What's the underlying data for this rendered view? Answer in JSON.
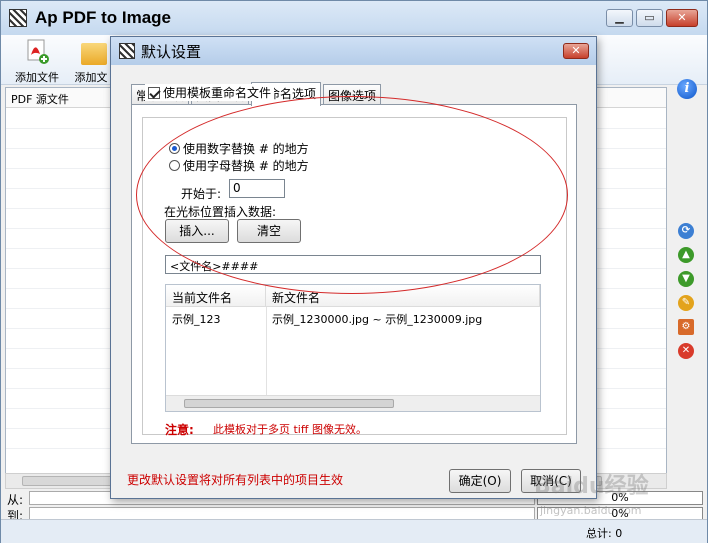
{
  "main": {
    "title": "Ap PDF to Image",
    "toolbar": {
      "add_file": "添加文件",
      "add_folder": "添加文"
    },
    "list_header": "PDF 源文件",
    "from_label": "从:",
    "to_label": "到:",
    "progress1": "0%",
    "progress2": "0%",
    "total": "总计: 0"
  },
  "dialog": {
    "title": "默认设置",
    "tabs": [
      "常规选项",
      "页面选项",
      "重命名选项",
      "图像选项"
    ],
    "active_tab": 2,
    "use_template_label": "使用模板重命名文件",
    "use_template_checked": true,
    "radio_number": "使用数字替换 # 的地方",
    "radio_letter": "使用字母替换 # 的地方",
    "selected_radio": "number",
    "start_label": "开始于:",
    "start_value": "0",
    "insert_label": "在光标位置插入数据:",
    "insert_button": "插入...",
    "clear_button": "清空",
    "template_value": "<文件名>####",
    "table": {
      "headers": [
        "当前文件名",
        "新文件名"
      ],
      "rows": [
        [
          "示例_123",
          "示例_1230000.jpg ~ 示例_1230009.jpg"
        ]
      ]
    },
    "note_label": "注意:",
    "note_text": "此模板对于多页 tiff 图像无效。",
    "footer_note": "更改默认设置将对所有列表中的项目生效",
    "ok_button": "确定(O)",
    "cancel_button": "取消(C)"
  },
  "watermark": "Baidu经验",
  "watermark_url": "jingyan.baidu.com"
}
